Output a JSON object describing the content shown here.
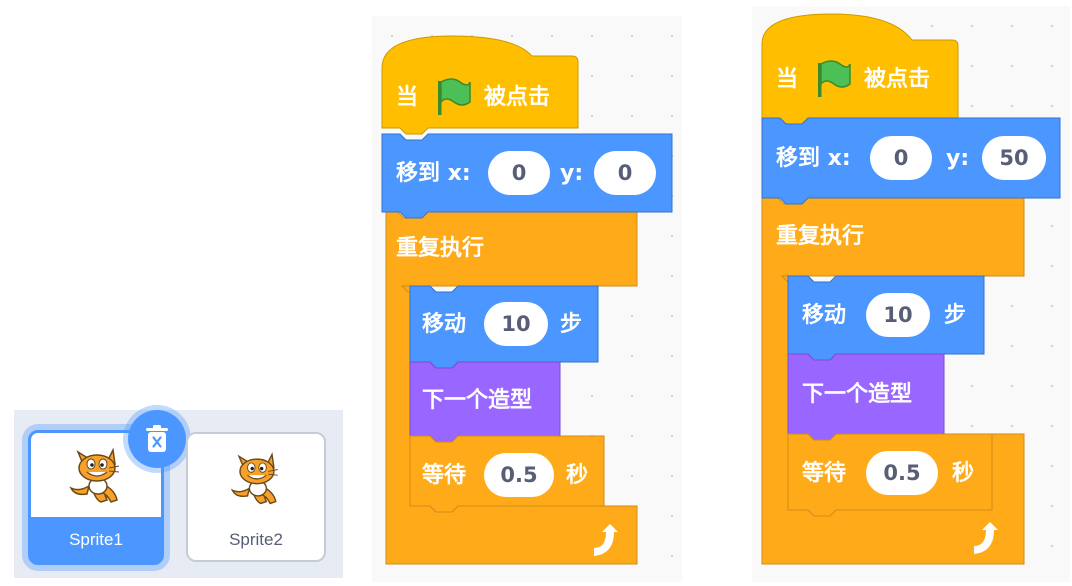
{
  "sprites": [
    {
      "name": "Sprite1",
      "selected": true
    },
    {
      "name": "Sprite2",
      "selected": false
    }
  ],
  "colors": {
    "events": "#ffbf00",
    "motion": "#4c97ff",
    "control": "#ffab19",
    "looks": "#9966ff",
    "selection": "#4c97ff"
  },
  "scripts": [
    {
      "hat": {
        "pre": "当",
        "post": "被点击"
      },
      "goto": {
        "label": "移到 x:",
        "x": "0",
        "ylabel": "y:",
        "y": "0"
      },
      "forever": {
        "label": "重复执行"
      },
      "move": {
        "label": "移动",
        "steps": "10",
        "unit": "步"
      },
      "next_costume": {
        "label": "下一个造型"
      },
      "wait": {
        "label": "等待",
        "secs": "0.5",
        "unit": "秒"
      }
    },
    {
      "hat": {
        "pre": "当",
        "post": "被点击"
      },
      "goto": {
        "label": "移到 x:",
        "x": "0",
        "ylabel": "y:",
        "y": "50"
      },
      "forever": {
        "label": "重复执行"
      },
      "move": {
        "label": "移动",
        "steps": "10",
        "unit": "步"
      },
      "next_costume": {
        "label": "下一个造型"
      },
      "wait": {
        "label": "等待",
        "secs": "0.5",
        "unit": "秒"
      }
    }
  ]
}
